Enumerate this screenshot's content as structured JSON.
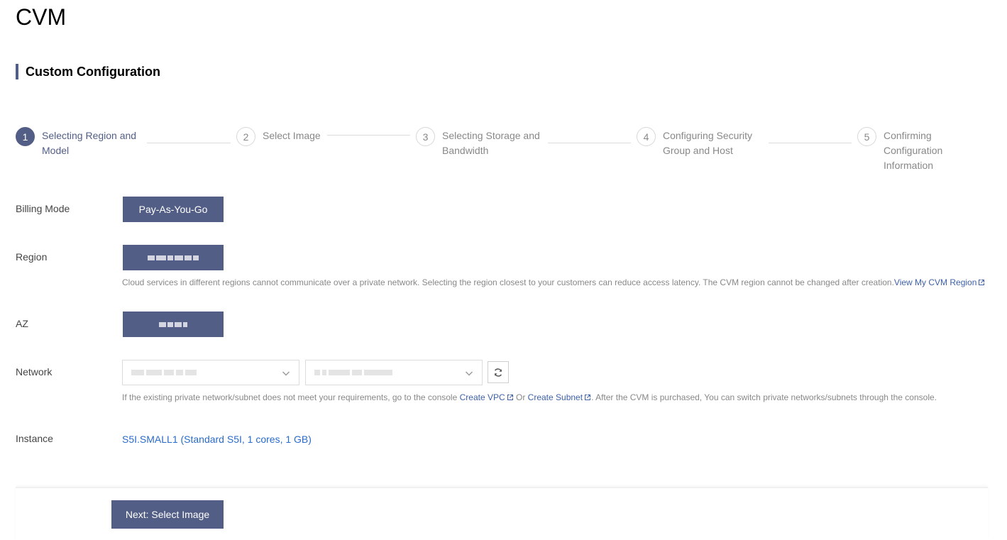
{
  "page": {
    "title": "CVM",
    "section": "Custom Configuration"
  },
  "steps": [
    {
      "num": "1",
      "label": "Selecting Region and Model",
      "active": true
    },
    {
      "num": "2",
      "label": "Select Image",
      "active": false
    },
    {
      "num": "3",
      "label": "Selecting Storage and Bandwidth",
      "active": false
    },
    {
      "num": "4",
      "label": "Configuring Security Group and Host",
      "active": false
    },
    {
      "num": "5",
      "label": "Confirming Configuration Information",
      "active": false
    }
  ],
  "form": {
    "billing": {
      "label": "Billing Mode",
      "value": "Pay-As-You-Go"
    },
    "region": {
      "label": "Region",
      "hint": "Cloud services in different regions cannot communicate over a private network. Selecting the region closest to your customers can reduce access latency. The CVM region cannot be changed after creation.",
      "link": "View My CVM Region"
    },
    "az": {
      "label": "AZ"
    },
    "network": {
      "label": "Network",
      "hint_before": "If the existing private network/subnet does not meet your requirements, go to the console",
      "link_vpc": "Create VPC",
      "hint_or": "Or",
      "link_subnet": "Create Subnet",
      "hint_after": ". After the CVM is purchased, You can switch private networks/subnets through the console."
    },
    "instance": {
      "label": "Instance",
      "value": "S5I.SMALL1 (Standard S5I, 1 cores, 1 GB)"
    }
  },
  "footer": {
    "next_label": "Next: Select Image"
  },
  "colors": {
    "primary": "#525e85",
    "link": "#3e60a8",
    "instance_link": "#2a6bc9"
  }
}
